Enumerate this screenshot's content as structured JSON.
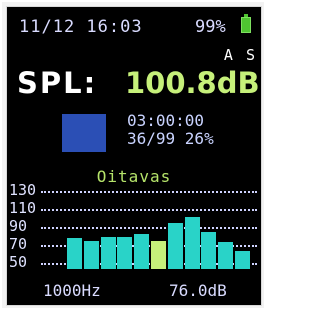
{
  "status": {
    "datetime": "11/12 16:03",
    "battery": "99%",
    "battery_icon": "battery-icon",
    "battery_color": "#4fc431"
  },
  "flags": "A S",
  "spl": {
    "label": "SPL:",
    "value": "100.8dB",
    "value_color": "#c6f07a",
    "indicator_color": "#2b4fb5"
  },
  "timer": {
    "elapsed": "03:00:00",
    "progress": "36/99 26%"
  },
  "chart_data": {
    "type": "bar",
    "title": "Oitavas",
    "y_ticks": [
      "130",
      "110",
      "90",
      "70",
      "50"
    ],
    "ylim": [
      50,
      130
    ],
    "values": [
      78,
      74,
      79,
      79,
      82,
      74,
      95,
      101,
      85,
      73,
      63
    ],
    "highlight_index": 5,
    "bar_color": "#29d3c8",
    "highlight_color": "#c6f07a",
    "selected_frequency": "1000Hz",
    "selected_level": "76.0dB"
  }
}
